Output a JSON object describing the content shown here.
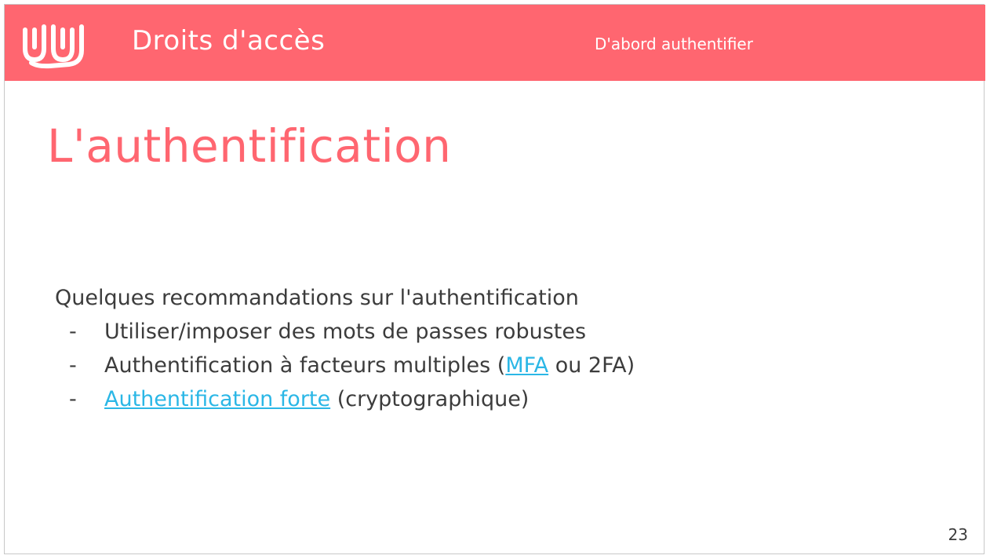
{
  "colors": {
    "brand": "#ff6670",
    "link": "#2bb7e6",
    "text": "#3c3c3c"
  },
  "header": {
    "logo_icon": "wavy-lines-logo-icon",
    "title": "Droits d'accès",
    "subtitle": "D'abord authentifier"
  },
  "slide": {
    "title": "L'authentification",
    "intro": "Quelques recommandations sur l'authentification",
    "bullets": [
      {
        "dash": "-",
        "text": "Utiliser/imposer des mots de passes robustes"
      },
      {
        "dash": "-",
        "prefix": "Authentification à facteurs multiples (",
        "link": "MFA",
        "suffix": " ou 2FA)"
      },
      {
        "dash": "-",
        "link": "Authentification forte",
        "suffix": " (cryptographique)"
      }
    ],
    "page_number": "23"
  }
}
